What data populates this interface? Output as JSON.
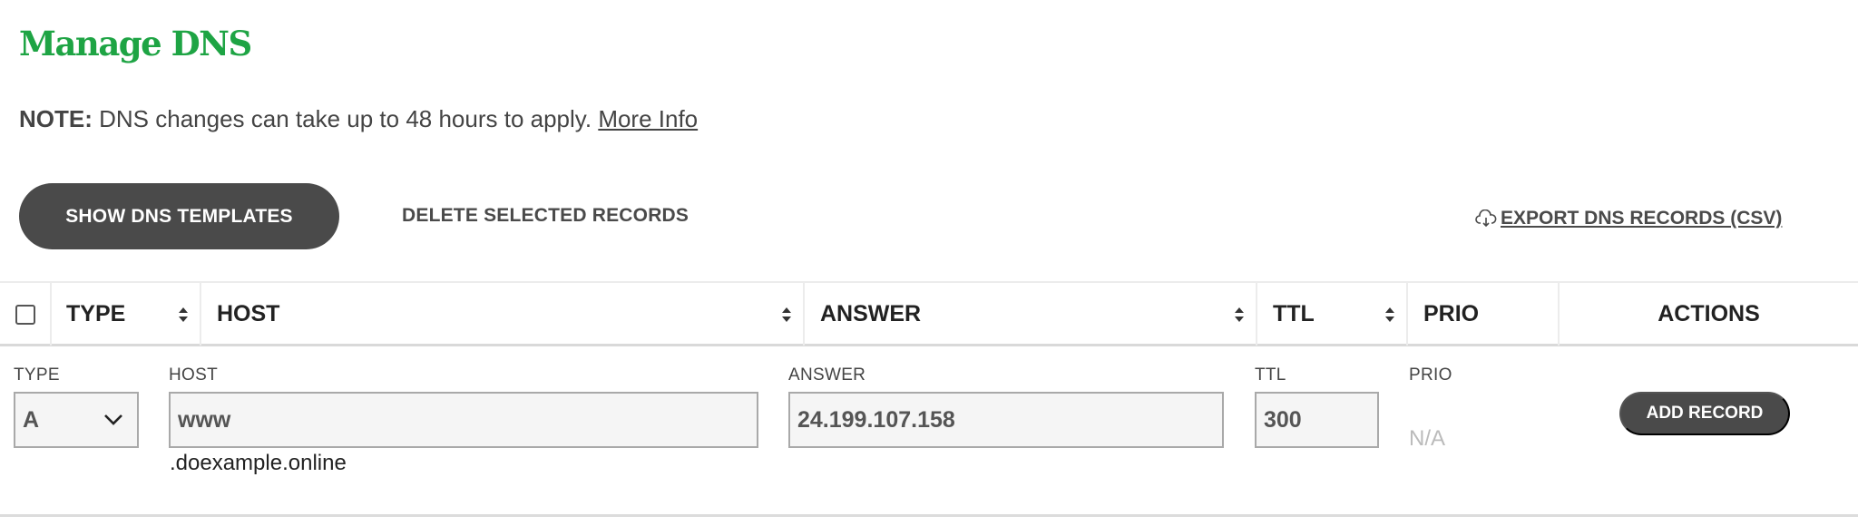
{
  "page": {
    "title": "Manage DNS"
  },
  "note": {
    "label": "NOTE:",
    "text": " DNS changes can take up to 48 hours to apply. ",
    "link": "More Info"
  },
  "toolbar": {
    "show_templates": "SHOW DNS TEMPLATES",
    "delete_selected": "DELETE SELECTED RECORDS",
    "export": " EXPORT DNS RECORDS (CSV)",
    "export_icon": "cloud-download-icon"
  },
  "table": {
    "headers": {
      "type": "TYPE",
      "host": "HOST",
      "answer": "ANSWER",
      "ttl": "TTL",
      "prio": "PRIO",
      "actions": "ACTIONS"
    }
  },
  "new_record": {
    "labels": {
      "type": "TYPE",
      "host": "HOST",
      "answer": "ANSWER",
      "ttl": "TTL",
      "prio": "PRIO"
    },
    "type_value": "A",
    "host_value": "www",
    "host_suffix": ".doexample.online",
    "answer_value": "24.199.107.158",
    "ttl_value": "300",
    "prio_value": "N/A",
    "add_button": "ADD RECORD"
  },
  "colors": {
    "brand_green": "#1ea444",
    "button_dark": "#4a4a4a"
  }
}
